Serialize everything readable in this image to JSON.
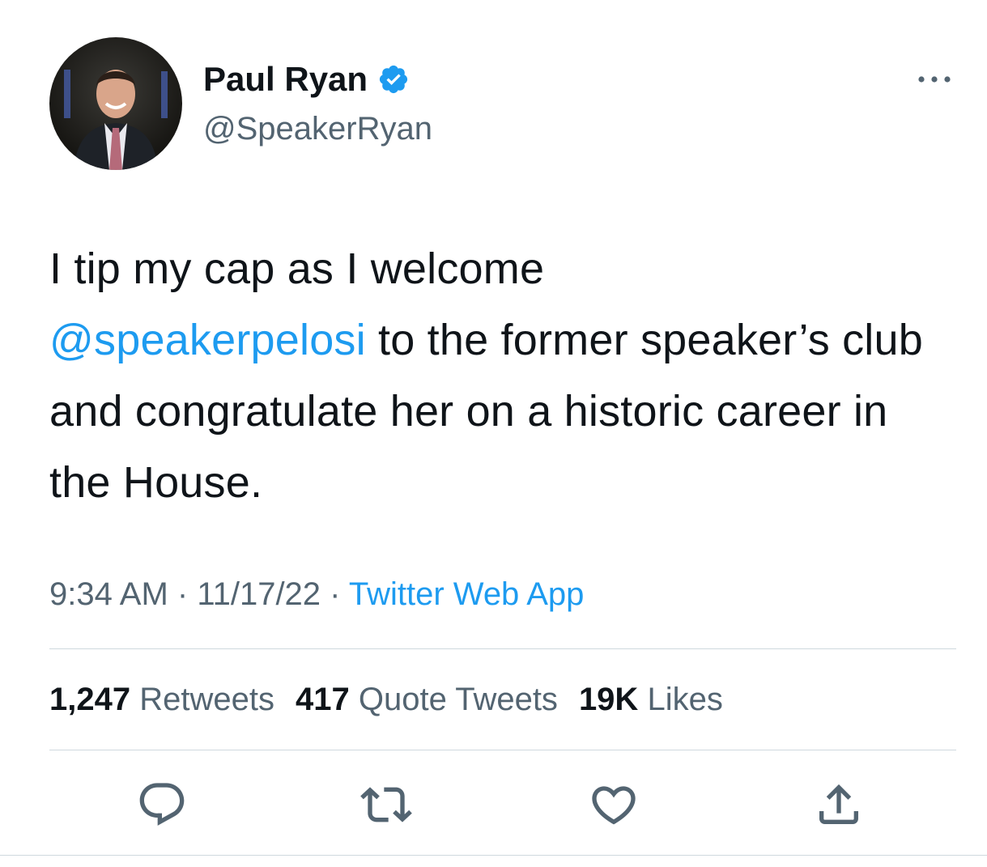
{
  "author": {
    "display_name": "Paul Ryan",
    "handle": "@SpeakerRyan",
    "verified": true
  },
  "tweet": {
    "text_before": "I tip my cap as I welcome",
    "mention": "@speakerpelosi",
    "text_after": " to the former speaker’s club and congratulate her on a historic career in the House."
  },
  "meta": {
    "time": "9:34 AM",
    "separator": " · ",
    "date": "11/17/22",
    "source": "Twitter Web App"
  },
  "stats": {
    "retweets_count": "1,247",
    "retweets_label": "Retweets",
    "quotes_count": "417",
    "quotes_label": "Quote Tweets",
    "likes_count": "19K",
    "likes_label": "Likes"
  },
  "actions": {
    "reply_icon": "reply-icon",
    "retweet_icon": "retweet-icon",
    "like_icon": "heart-icon",
    "share_icon": "share-icon"
  },
  "colors": {
    "accent": "#1d9bf0",
    "secondary_text": "#536471",
    "divider": "#cfd9de"
  }
}
